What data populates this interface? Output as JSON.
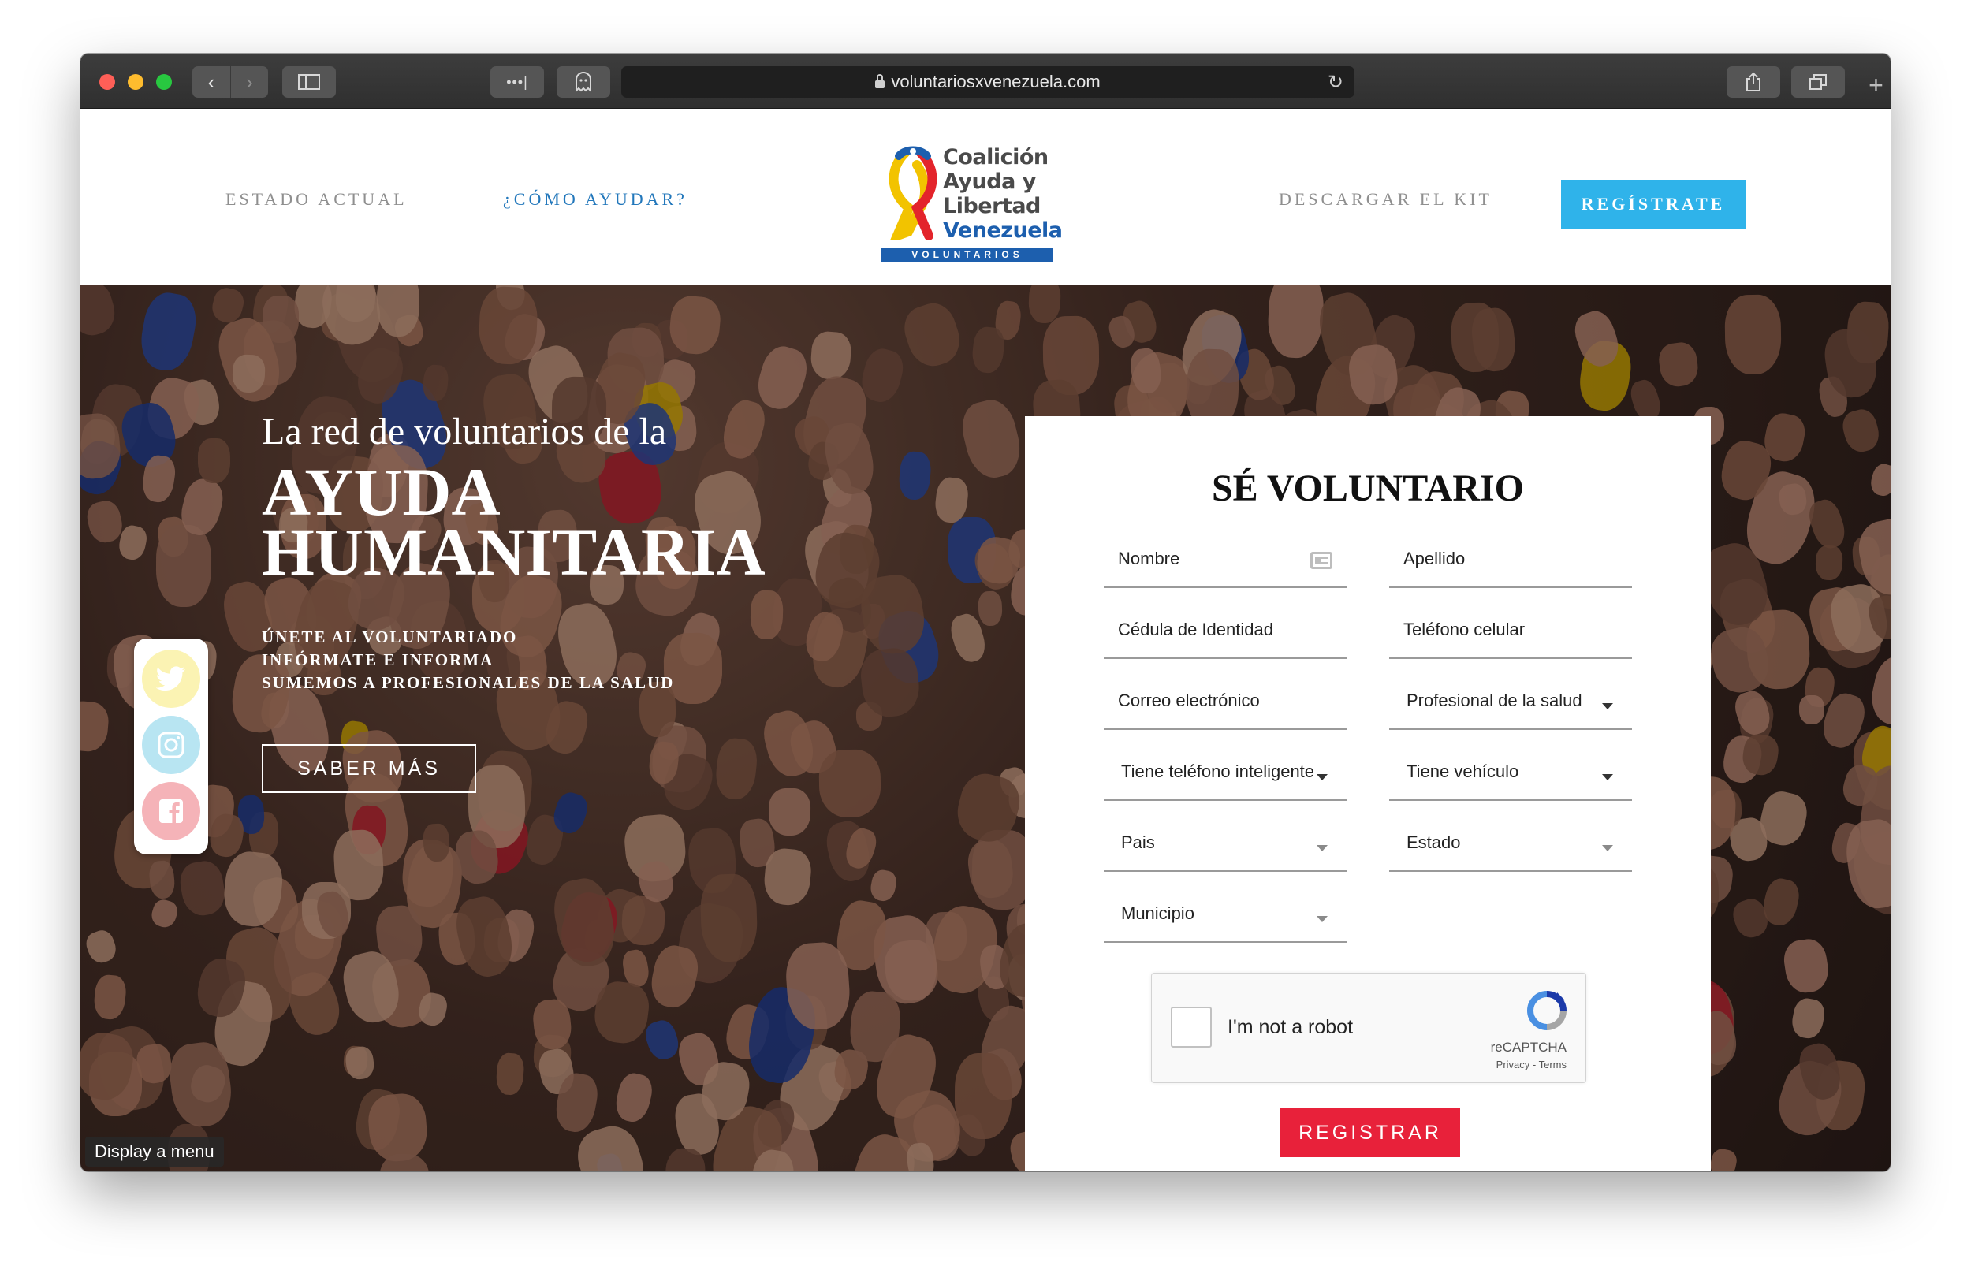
{
  "browser": {
    "url": "voluntariosxvenezuela.com",
    "back_icon": "chevron-left-icon",
    "forward_icon": "chevron-right-icon"
  },
  "nav": {
    "estado_actual": "ESTADO ACTUAL",
    "como_ayudar": "¿CÓMO AYUDAR?",
    "descargar_kit": "DESCARGAR EL KIT",
    "registrate": "REGÍSTRATE"
  },
  "logo": {
    "line1": "Coalición",
    "line2": "Ayuda y",
    "line3": "Libertad",
    "line4": "Venezuela",
    "tag": "VOLUNTARIOS"
  },
  "hero": {
    "pre_title": "La red de voluntarios de la",
    "title_line1": "AYUDA",
    "title_line2": "HUMANITARIA",
    "items": [
      "ÚNETE AL VOLUNTARIADO",
      "INFÓRMATE E INFORMA",
      "SUMEMOS A PROFESIONALES DE LA SALUD"
    ],
    "cta": "SABER MÁS"
  },
  "social": [
    "twitter-icon",
    "instagram-icon",
    "facebook-icon"
  ],
  "form": {
    "title": "SÉ VOLUNTARIO",
    "fields": {
      "nombre": "Nombre",
      "apellido": "Apellido",
      "cedula": "Cédula de Identidad",
      "telefono": "Teléfono celular",
      "correo": "Correo electrónico",
      "profesional": "Profesional de la salud",
      "smartphone": "Tiene teléfono inteligente",
      "vehiculo": "Tiene vehículo",
      "pais": "Pais",
      "estado": "Estado",
      "municipio": "Municipio"
    },
    "captcha": {
      "label": "I'm not a robot",
      "brand": "reCAPTCHA",
      "links": "Privacy - Terms"
    },
    "submit": "REGISTRAR"
  },
  "display_menu": "Display a menu",
  "colors": {
    "accent_blue": "#2fb3ea",
    "link_blue": "#2277bb",
    "submit_red": "#e8213a"
  }
}
